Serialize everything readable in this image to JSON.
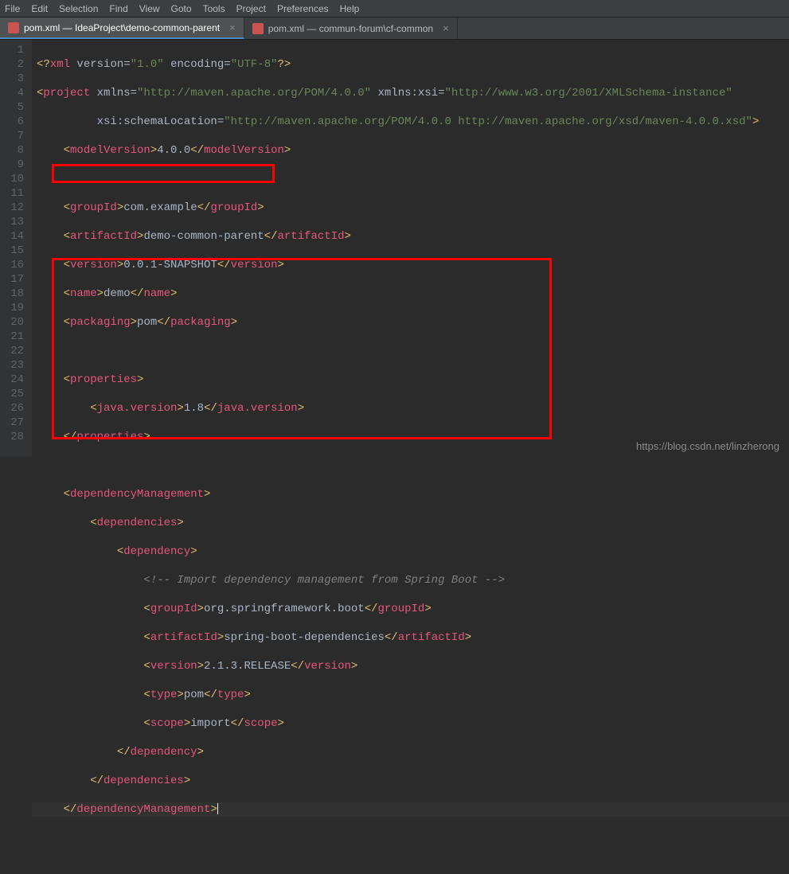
{
  "menubar": [
    "File",
    "Edit",
    "Selection",
    "Find",
    "View",
    "Goto",
    "Tools",
    "Project",
    "Preferences",
    "Help"
  ],
  "tabs": [
    {
      "label": "pom.xml — IdeaProject\\demo-common-parent",
      "active": true
    },
    {
      "label": "pom.xml — commun-forum\\cf-common",
      "active": false
    }
  ],
  "lines": {
    "l1": {
      "pre": "<?",
      "nm": "xml",
      "attrs": " version=",
      "v1": "\"1.0\"",
      "attrs2": " encoding=",
      "v2": "\"UTF-8\"",
      "post": "?>"
    },
    "l2": {
      "open": "<",
      "nm": "project",
      "a1": " xmlns=",
      "v1": "\"http://maven.apache.org/POM/4.0.0\"",
      "a2": " xmlns:xsi=",
      "v2": "\"http://www.w3.org/2001/XMLSchema-instance\""
    },
    "l3": {
      "a": "         xsi:schemaLocation=",
      "v": "\"http://maven.apache.org/POM/4.0.0 http://maven.apache.org/xsd/maven-4.0.0.xsd\"",
      "c": ">"
    },
    "l4": {
      "o": "    <",
      "n": "modelVersion",
      "c": ">",
      "t": "4.0.0",
      "o2": "</",
      "c2": ">"
    },
    "l6": {
      "o": "    <",
      "n": "groupId",
      "c": ">",
      "t": "com.example",
      "o2": "</",
      "c2": ">"
    },
    "l7": {
      "o": "    <",
      "n": "artifactId",
      "c": ">",
      "t": "demo-common-parent",
      "o2": "</",
      "c2": ">"
    },
    "l8": {
      "o": "    <",
      "n": "version",
      "c": ">",
      "t": "0.0.1-SNAPSHOT",
      "o2": "</",
      "c2": ">"
    },
    "l9": {
      "o": "    <",
      "n": "name",
      "c": ">",
      "t": "demo",
      "o2": "</",
      "c2": ">"
    },
    "l10": {
      "o": "    <",
      "n": "packaging",
      "c": ">",
      "t": "pom",
      "o2": "</",
      "c2": ">"
    },
    "l12": {
      "o": "    <",
      "n": "properties",
      "c": ">"
    },
    "l13": {
      "o": "        <",
      "n": "java.version",
      "c": ">",
      "t": "1.8",
      "o2": "</",
      "c2": ">"
    },
    "l14": {
      "o": "    </",
      "n": "properties",
      "c": ">"
    },
    "l16": {
      "o": "    <",
      "n": "dependencyManagement",
      "c": ">"
    },
    "l17": {
      "o": "        <",
      "n": "dependencies",
      "c": ">"
    },
    "l18": {
      "o": "            <",
      "n": "dependency",
      "c": ">"
    },
    "l19": {
      "t": "                <!-- Import dependency management from Spring Boot -->"
    },
    "l20": {
      "o": "                <",
      "n": "groupId",
      "c": ">",
      "t": "org.springframework.boot",
      "o2": "</",
      "c2": ">"
    },
    "l21": {
      "o": "                <",
      "n": "artifactId",
      "c": ">",
      "t": "spring-boot-dependencies",
      "o2": "</",
      "c2": ">"
    },
    "l22": {
      "o": "                <",
      "n": "version",
      "c": ">",
      "t": "2.1.3.RELEASE",
      "o2": "</",
      "c2": ">"
    },
    "l23": {
      "o": "                <",
      "n": "type",
      "c": ">",
      "t": "pom",
      "o2": "</",
      "c2": ">"
    },
    "l24": {
      "o": "                <",
      "n": "scope",
      "c": ">",
      "t": "import",
      "o2": "</",
      "c2": ">"
    },
    "l25": {
      "o": "            </",
      "n": "dependency",
      "c": ">"
    },
    "l26": {
      "o": "        </",
      "n": "dependencies",
      "c": ">"
    },
    "l27": {
      "o": "    </",
      "n": "dependencyManagement",
      "c": ">"
    }
  },
  "watermark": "https://blog.csdn.net/linzherong",
  "linecount": 28
}
